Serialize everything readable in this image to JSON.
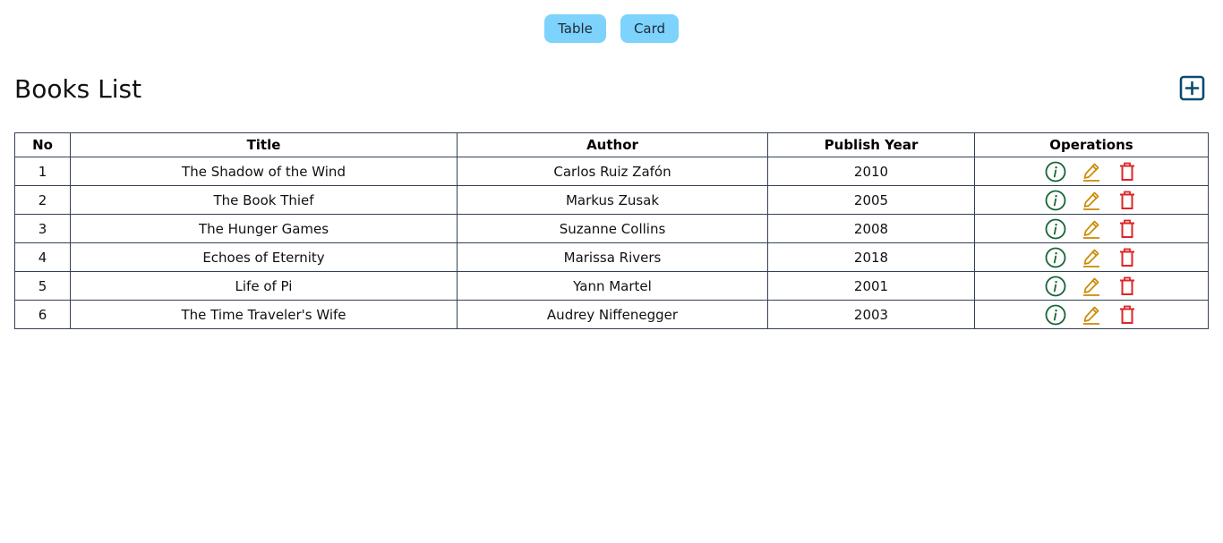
{
  "view_toggle": {
    "table_label": "Table",
    "card_label": "Card"
  },
  "header": {
    "title": "Books List",
    "add_icon": "plus-square-icon"
  },
  "table": {
    "columns": [
      "No",
      "Title",
      "Author",
      "Publish Year",
      "Operations"
    ],
    "rows": [
      {
        "no": "1",
        "title": "The Shadow of the Wind",
        "author": "Carlos Ruiz Zafón",
        "year": "2010"
      },
      {
        "no": "2",
        "title": "The Book Thief",
        "author": "Markus Zusak",
        "year": "2005"
      },
      {
        "no": "3",
        "title": "The Hunger Games",
        "author": "Suzanne Collins",
        "year": "2008"
      },
      {
        "no": "4",
        "title": "Echoes of Eternity",
        "author": "Marissa Rivers",
        "year": "2018"
      },
      {
        "no": "5",
        "title": "Life of Pi",
        "author": "Yann Martel",
        "year": "2001"
      },
      {
        "no": "6",
        "title": "The Time Traveler's Wife",
        "author": "Audrey Niffenegger",
        "year": "2003"
      }
    ],
    "operation_icons": [
      "info-circle-icon",
      "edit-pencil-icon",
      "trash-icon"
    ]
  },
  "colors": {
    "toggle_bg": "#7dd3fc",
    "add_icon": "#0c4a6e",
    "info_icon": "#166534",
    "edit_icon": "#ca8a04",
    "delete_icon": "#dc2626",
    "table_border": "#334155"
  }
}
